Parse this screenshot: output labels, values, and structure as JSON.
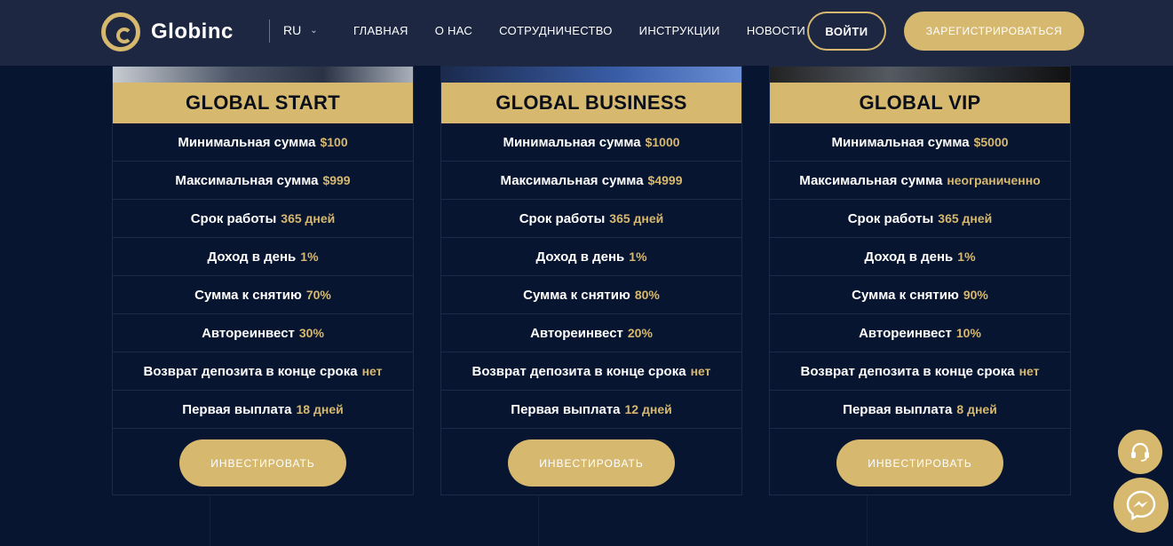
{
  "header": {
    "logo_text": "Globinc",
    "lang": "RU",
    "nav": [
      "ГЛАВНАЯ",
      "О НАС",
      "СОТРУДНИЧЕСТВО",
      "ИНСТРУКЦИИ",
      "НОВОСТИ"
    ],
    "login_label": "ВОЙТИ",
    "register_label": "ЗАРЕГИСТРИРОВАТЬСЯ"
  },
  "colors": {
    "accent": "#d6b86f",
    "background": "#071530",
    "header": "#1d2741"
  },
  "plans": [
    {
      "title": "GLOBAL START",
      "rows": [
        {
          "label": "Минимальная сумма",
          "value": "$100"
        },
        {
          "label": "Максимальная сумма",
          "value": "$999"
        },
        {
          "label": "Срок работы",
          "value": "365 дней"
        },
        {
          "label": "Доход в день",
          "value": "1%"
        },
        {
          "label": "Сумма к снятию",
          "value": "70%"
        },
        {
          "label": "Автореинвест",
          "value": "30%"
        },
        {
          "label": "Возврат депозита в конце срока",
          "value": "нет"
        },
        {
          "label": "Первая выплата",
          "value": "18 дней"
        }
      ],
      "button": "ИНВЕСТИРОВАТЬ"
    },
    {
      "title": "GLOBAL BUSINESS",
      "rows": [
        {
          "label": "Минимальная сумма",
          "value": "$1000"
        },
        {
          "label": "Максимальная сумма",
          "value": "$4999"
        },
        {
          "label": "Срок работы",
          "value": "365 дней"
        },
        {
          "label": "Доход в день",
          "value": "1%"
        },
        {
          "label": "Сумма к снятию",
          "value": "80%"
        },
        {
          "label": "Автореинвест",
          "value": "20%"
        },
        {
          "label": "Возврат депозита в конце срока",
          "value": "нет"
        },
        {
          "label": "Первая выплата",
          "value": "12 дней"
        }
      ],
      "button": "ИНВЕСТИРОВАТЬ"
    },
    {
      "title": "GLOBAL VIP",
      "rows": [
        {
          "label": "Минимальная сумма",
          "value": "$5000"
        },
        {
          "label": "Максимальная сумма",
          "value": "неограниченно"
        },
        {
          "label": "Срок работы",
          "value": "365 дней"
        },
        {
          "label": "Доход в день",
          "value": "1%"
        },
        {
          "label": "Сумма к снятию",
          "value": "90%"
        },
        {
          "label": "Автореинвест",
          "value": "10%"
        },
        {
          "label": "Возврат депозита в конце срока",
          "value": "нет"
        },
        {
          "label": "Первая выплата",
          "value": "8 дней"
        }
      ],
      "button": "ИНВЕСТИРОВАТЬ"
    }
  ],
  "icons": {
    "support": "headset-icon",
    "messenger": "messenger-icon",
    "lang_toggle": "chevron-down-icon"
  }
}
